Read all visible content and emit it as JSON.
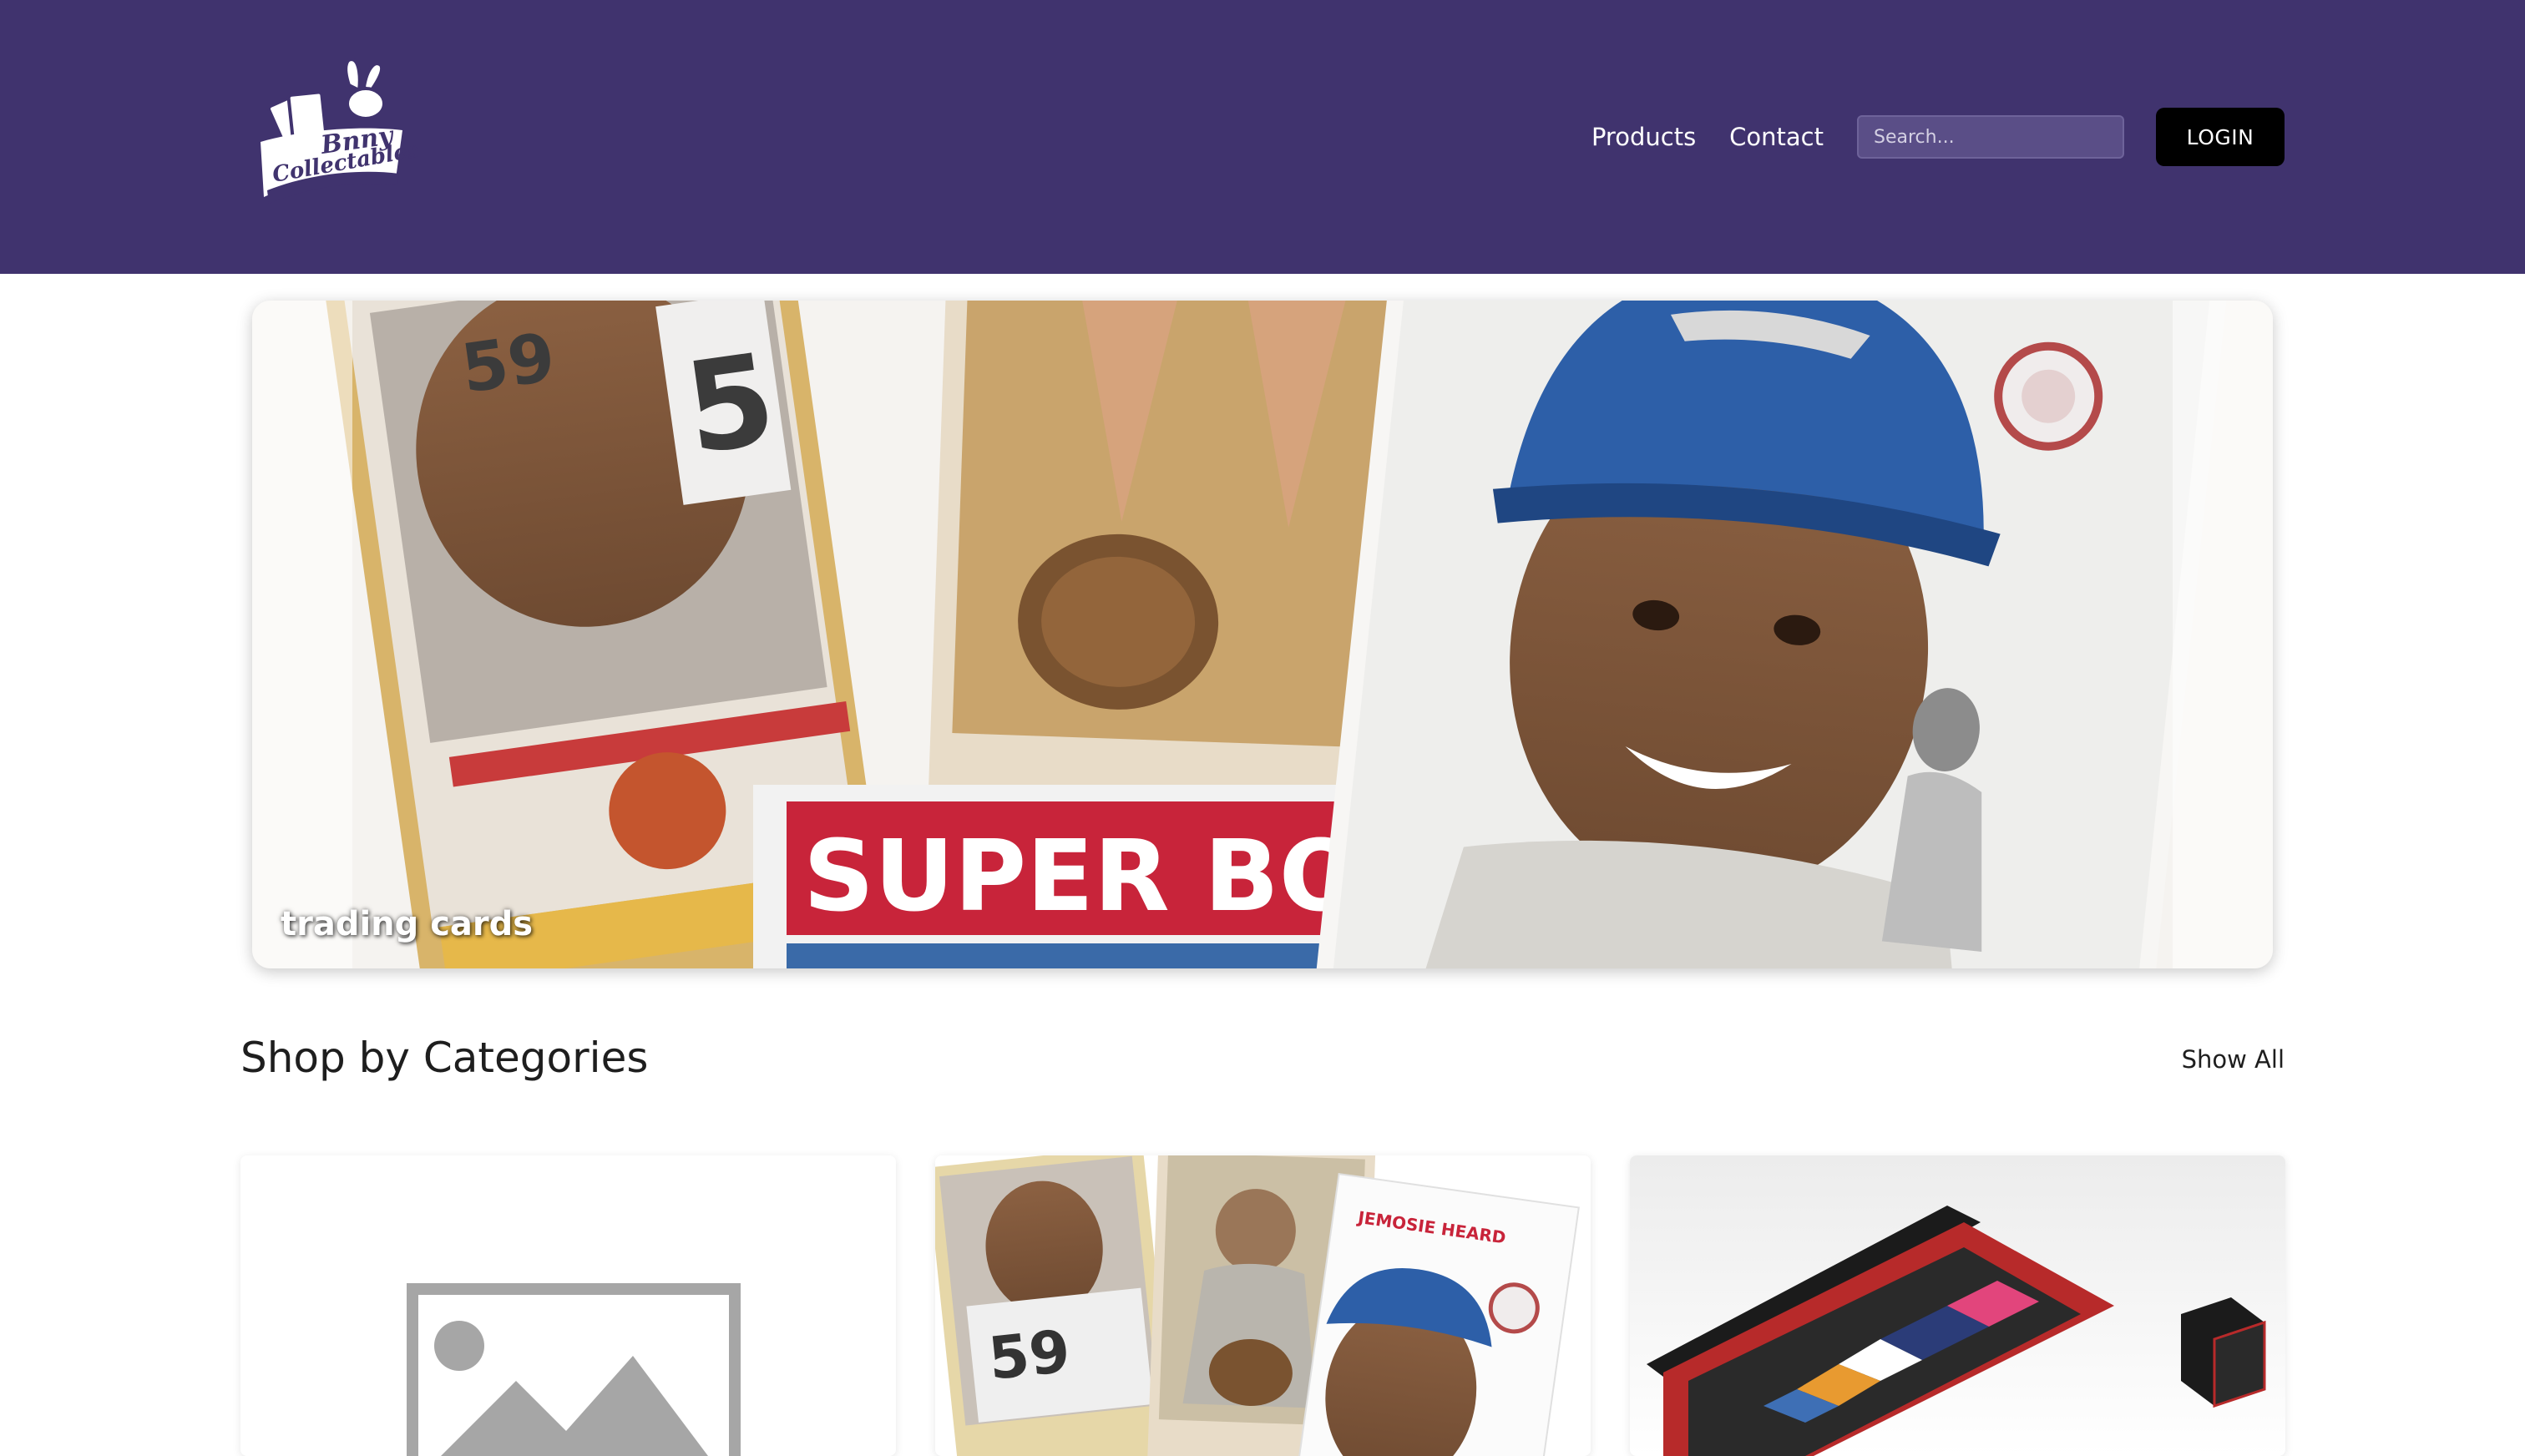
{
  "header": {
    "logo_text_line1": "Bnny",
    "logo_text_line2": "Collectables",
    "nav": {
      "products": "Products",
      "contact": "Contact"
    },
    "search": {
      "placeholder": "Search...",
      "value": ""
    },
    "login_label": "LOGIN"
  },
  "hero": {
    "caption": "trading cards",
    "card_text": "SUPER BOWL"
  },
  "categories": {
    "title": "Shop by Categories",
    "show_all": "Show All",
    "cards": [
      {
        "image": "placeholder-image-icon"
      },
      {
        "image": "trading-cards-photo",
        "card_text": "JEMOSIE HEARD"
      },
      {
        "image": "card-storage-box-photo"
      }
    ]
  },
  "colors": {
    "header_bg": "#40336e",
    "login_bg": "#000000",
    "accent_red": "#c8243a",
    "cap_blue": "#2d5fa8"
  }
}
